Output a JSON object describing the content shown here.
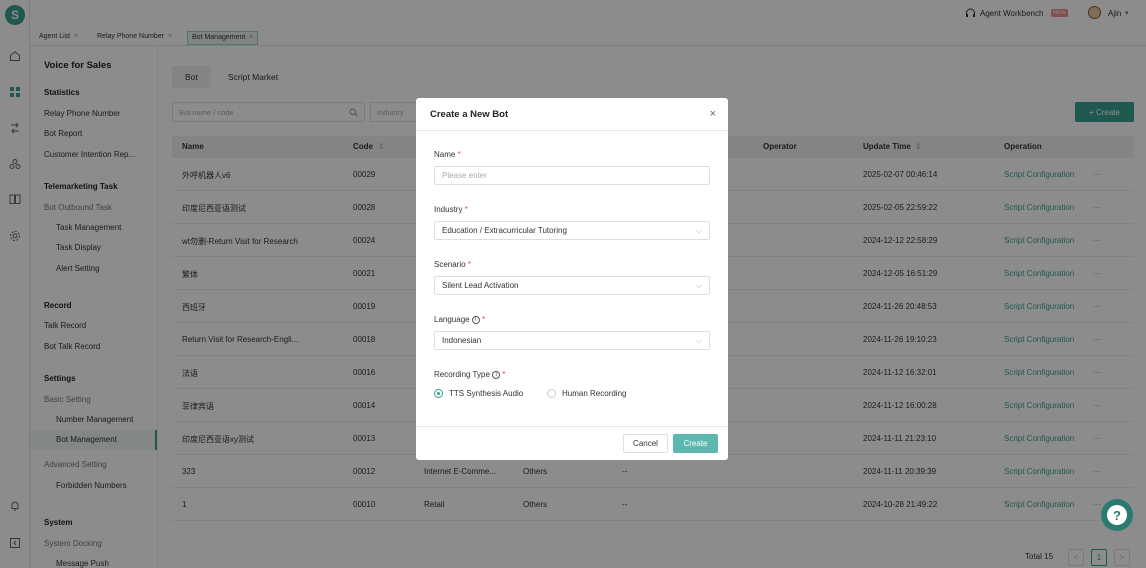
{
  "app": {
    "logo": "S"
  },
  "topbar": {
    "workbench": "Agent Workbench",
    "new_badge": "NEW",
    "user": "Ajin",
    "caret": "▾"
  },
  "tabs": [
    {
      "label": "Agent List"
    },
    {
      "label": "Relay Phone Number"
    },
    {
      "label": "Bot Management"
    }
  ],
  "sidebar": {
    "title": "Voice for Sales",
    "statistics": "Statistics",
    "relay_phone_number": "Relay Phone Number",
    "bot_report": "Bot Report",
    "customer_intention": "Customer Intention Rep...",
    "telemarketing_task": "Telemarketing Task",
    "bot_outbound_task": "Bot Outbound Task",
    "task_management": "Task Management",
    "task_display": "Task Display",
    "alert_setting": "Alert Setting",
    "record": "Record",
    "talk_record": "Talk Record",
    "bot_talk_record": "Bot Talk Record",
    "settings": "Settings",
    "basic_setting": "Basic Setting",
    "number_management": "Number Management",
    "bot_management": "Bot Management",
    "advanced_setting": "Advanced Setting",
    "forbidden_numbers": "Forbidden Numbers",
    "system": "System",
    "system_docking": "System Docking",
    "message_push": "Message Push"
  },
  "main": {
    "subtabs": [
      "Bot",
      "Script Market"
    ],
    "search_placeholder": "Bot name / code",
    "industry_placeholder": "Industry",
    "create_button": "+ Create",
    "columns": {
      "name": "Name",
      "code": "Code",
      "operator": "Operator",
      "update_time": "Update Time",
      "operation": "Operation"
    },
    "sort_icon": "⇕",
    "op_link": "Script Configuration",
    "more": "···",
    "rows": [
      {
        "name": "外呼机器人v6",
        "code": "00029",
        "industry": "",
        "scenario": "",
        "operator": "",
        "time": "2025-02-07 00:46:14"
      },
      {
        "name": "印度尼西亚语测试",
        "code": "00028",
        "industry": "",
        "scenario": "",
        "operator": "",
        "time": "2025-02-05 22:59:22"
      },
      {
        "name": "wt勿删-Return Visit for Research",
        "code": "00024",
        "industry": "",
        "scenario": "",
        "operator": "",
        "time": "2024-12-12 22:58:29"
      },
      {
        "name": "繁体",
        "code": "00021",
        "industry": "",
        "scenario": "",
        "operator": "",
        "time": "2024-12-05 16:51:29"
      },
      {
        "name": "西班牙",
        "code": "00019",
        "industry": "",
        "scenario": "",
        "operator": "",
        "time": "2024-11-26 20:48:53"
      },
      {
        "name": "Return Visit for Research-Engli...",
        "code": "00018",
        "industry": "",
        "scenario": "",
        "operator": "",
        "time": "2024-11-26 19:10:23"
      },
      {
        "name": "法语",
        "code": "00016",
        "industry": "",
        "scenario": "",
        "operator": "",
        "time": "2024-11-12 16:32:01"
      },
      {
        "name": "菲律宾语",
        "code": "00014",
        "industry": "",
        "scenario": "",
        "operator": "",
        "time": "2024-11-12 16:00:28"
      },
      {
        "name": "印度尼西亚语xy测试",
        "code": "00013",
        "industry": "",
        "scenario": "",
        "operator": "",
        "time": "2024-11-11 21:23:10"
      },
      {
        "name": "323",
        "code": "00012",
        "industry": "Internet E-Comme...",
        "scenario": "Others",
        "operator": "--",
        "time": "2024-11-11 20:39:39"
      },
      {
        "name": "1",
        "code": "00010",
        "industry": "Retail",
        "scenario": "Others",
        "operator": "--",
        "time": "2024-10-28 21:49:22"
      }
    ],
    "total": "Total 15",
    "page": "1",
    "prev": "<",
    "next": ">"
  },
  "modal": {
    "title": "Create a New Bot",
    "close": "×",
    "name_label": "Name",
    "name_placeholder": "Please enter",
    "industry_label": "Industry",
    "industry_value": "Education / Extracurricular Tutoring",
    "scenario_label": "Scenario",
    "scenario_value": "Silent Lead Activation",
    "language_label": "Language",
    "language_value": "Indonesian",
    "recording_label": "Recording Type",
    "recording_options": [
      "TTS Synthesis Audio",
      "Human Recording"
    ],
    "cancel": "Cancel",
    "create": "Create",
    "required_mark": "*",
    "info_mark": "i",
    "chevron": "⌵"
  },
  "help": {
    "mark": "?"
  },
  "colors": {
    "accent": "#3a9e94",
    "required": "#e84a4a"
  }
}
